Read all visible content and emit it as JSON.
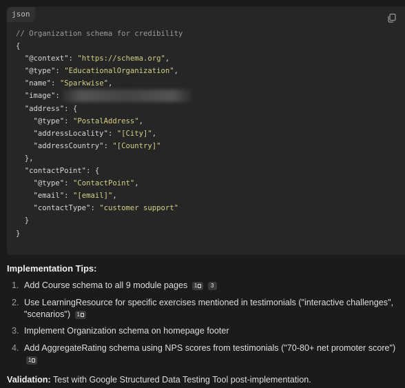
{
  "code_block": {
    "language": "json",
    "copy_icon": "copy-icon",
    "comment": "// Organization schema for credibility",
    "lines": {
      "open": "{",
      "context_key": "\"@context\"",
      "context_val": "\"https://schema.org\"",
      "type_key": "\"@type\"",
      "type_val": "\"EducationalOrganization\"",
      "name_key": "\"name\"",
      "name_val": "\"Sparkwise\"",
      "image_key": "\"image\"",
      "address_key": "\"address\"",
      "addr_type_key": "\"@type\"",
      "addr_type_val": "\"PostalAddress\"",
      "locality_key": "\"addressLocality\"",
      "locality_val": "\"[City]\"",
      "country_key": "\"addressCountry\"",
      "country_val": "\"[Country]\"",
      "addr_close": "},",
      "contact_key": "\"contactPoint\"",
      "cp_type_key": "\"@type\"",
      "cp_type_val": "\"ContactPoint\"",
      "email_key": "\"email\"",
      "email_val": "\"[email]\"",
      "ctype_key": "\"contactType\"",
      "ctype_val": "\"customer support\"",
      "cp_close": "}",
      "close": "}"
    }
  },
  "tips": {
    "title": "Implementation Tips:",
    "items": [
      {
        "num": "1.",
        "text": "Add Course schema to all 9 module pages",
        "badges": [
          "1",
          "3"
        ]
      },
      {
        "num": "2.",
        "text": "Use LearningResource for specific exercises mentioned in testimonials (\"interactive challenges\", \"scenarios\")",
        "badges": [
          "1"
        ]
      },
      {
        "num": "3.",
        "text": "Implement Organization schema on homepage footer",
        "badges": []
      },
      {
        "num": "4.",
        "text": "Add AggregateRating schema using NPS scores from testimonials (\"70-80+ net promoter score\")",
        "badges": [
          "1"
        ]
      }
    ]
  },
  "validation": {
    "label": "Validation:",
    "text": " Test with Google Structured Data Testing Tool post-implementation."
  },
  "colors": {
    "background": "#1b1b1b",
    "code_background": "#262626",
    "string": "#d2cf86",
    "comment": "#9a9a9a"
  }
}
